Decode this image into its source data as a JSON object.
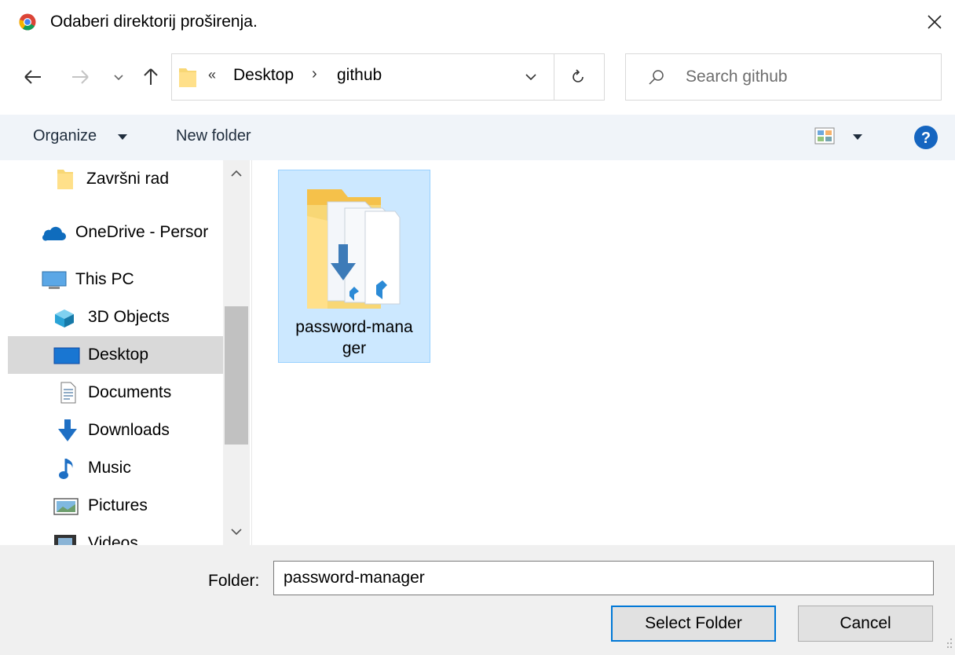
{
  "dialog": {
    "title": "Odaberi direktorij proširenja.",
    "icons": {
      "app": "chrome-icon",
      "close": "close-icon"
    }
  },
  "nav": {
    "icons": [
      "back-arrow-icon",
      "forward-arrow-icon",
      "chevron-down-icon",
      "up-arrow-icon"
    ]
  },
  "address": {
    "overflow": "«",
    "crumbs": [
      "Desktop",
      "github"
    ],
    "separator": "›",
    "icons": [
      "folder-icon",
      "dropdown-chevron-icon",
      "refresh-icon"
    ]
  },
  "search": {
    "placeholder": "Search github",
    "value": "",
    "icon": "search-icon"
  },
  "toolbar": {
    "organize": "Organize",
    "new_folder": "New folder",
    "icons": [
      "caret-down-icon",
      "view-options-icon",
      "help-icon"
    ],
    "help_color": "#1565c0"
  },
  "sidebar": {
    "items": [
      {
        "label": "Završni rad",
        "icon": "folder-icon"
      },
      {
        "label": "OneDrive - Persor",
        "icon": "onedrive-cloud-icon"
      },
      {
        "label": "This PC",
        "icon": "this-pc-icon"
      },
      {
        "label": "3D Objects",
        "icon": "3d-objects-icon"
      },
      {
        "label": "Desktop",
        "icon": "desktop-icon",
        "selected": true
      },
      {
        "label": "Documents",
        "icon": "documents-icon"
      },
      {
        "label": "Downloads",
        "icon": "downloads-icon"
      },
      {
        "label": "Music",
        "icon": "music-icon"
      },
      {
        "label": "Pictures",
        "icon": "pictures-icon"
      },
      {
        "label": "Videos",
        "icon": "videos-icon"
      }
    ]
  },
  "content": {
    "items": [
      {
        "name": "password-mana\nger",
        "icon": "vscode-folder-icon",
        "selected": true
      }
    ],
    "selection_color": "#cce8ff"
  },
  "footer": {
    "folder_label": "Folder:",
    "folder_value": "password-manager",
    "select_button": "Select Folder",
    "cancel_button": "Cancel",
    "accent": "#0078d7"
  }
}
